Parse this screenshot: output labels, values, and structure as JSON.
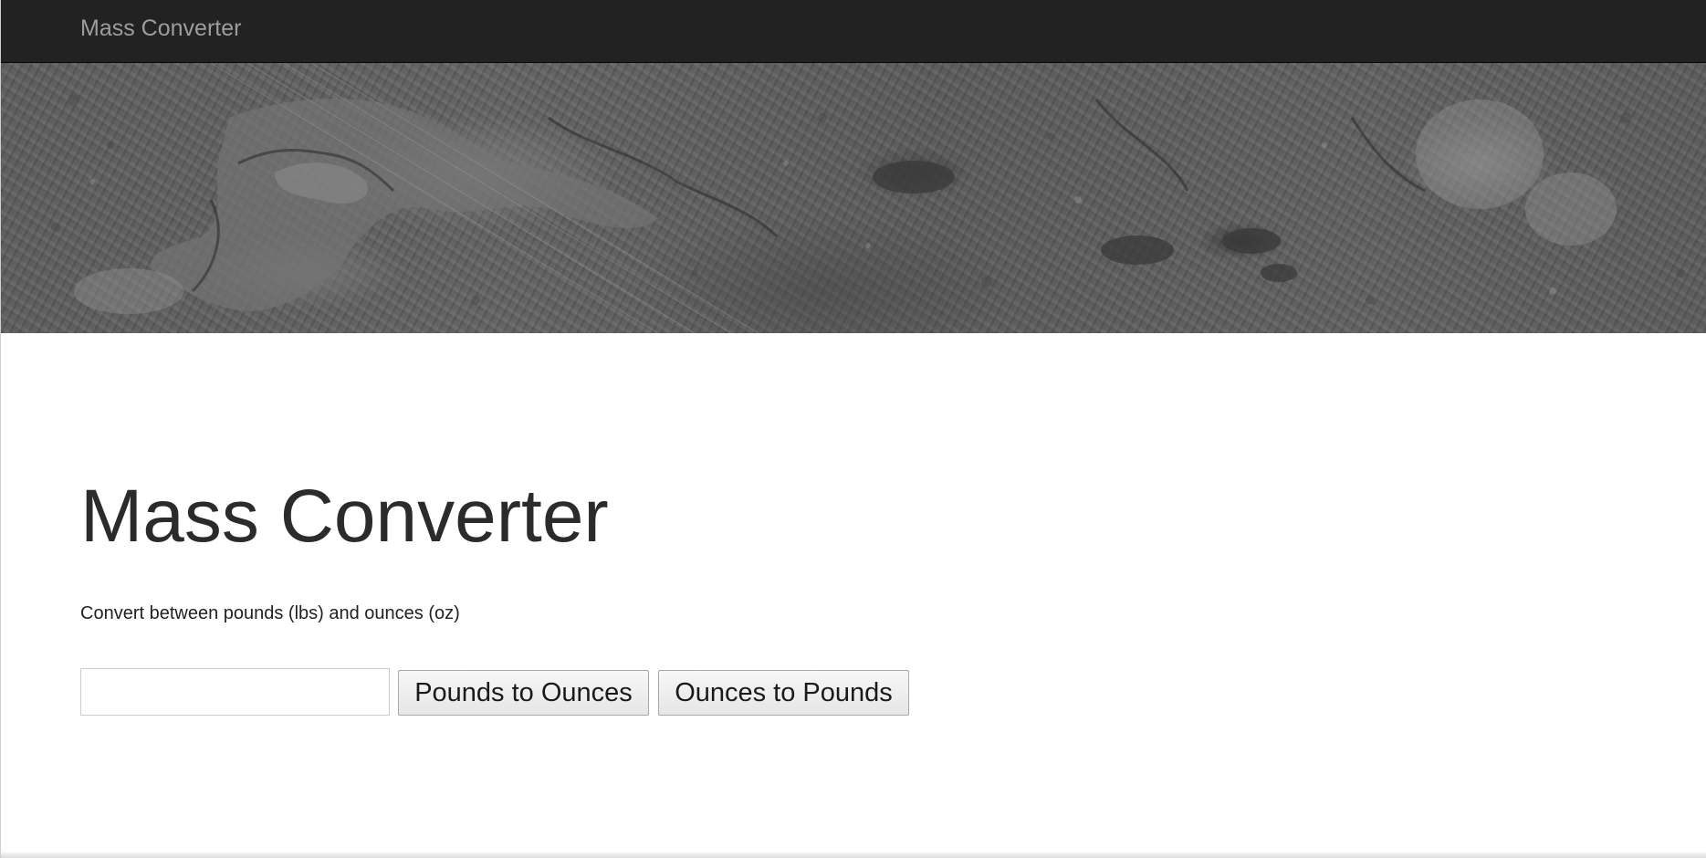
{
  "navbar": {
    "brand": "Mass Converter"
  },
  "hero": {
    "image": "grayscale-satellite-landscape"
  },
  "main": {
    "title": "Mass Converter",
    "subtitle": "Convert between pounds (lbs) and ounces (oz)",
    "input": {
      "value": "",
      "placeholder": ""
    },
    "buttons": {
      "lbs_to_oz": "Pounds to Ounces",
      "oz_to_lbs": "Ounces to Pounds"
    }
  },
  "colors": {
    "navbar_bg": "#222222",
    "brand_text": "#9d9d9d",
    "title_text": "#2b2b2b"
  }
}
